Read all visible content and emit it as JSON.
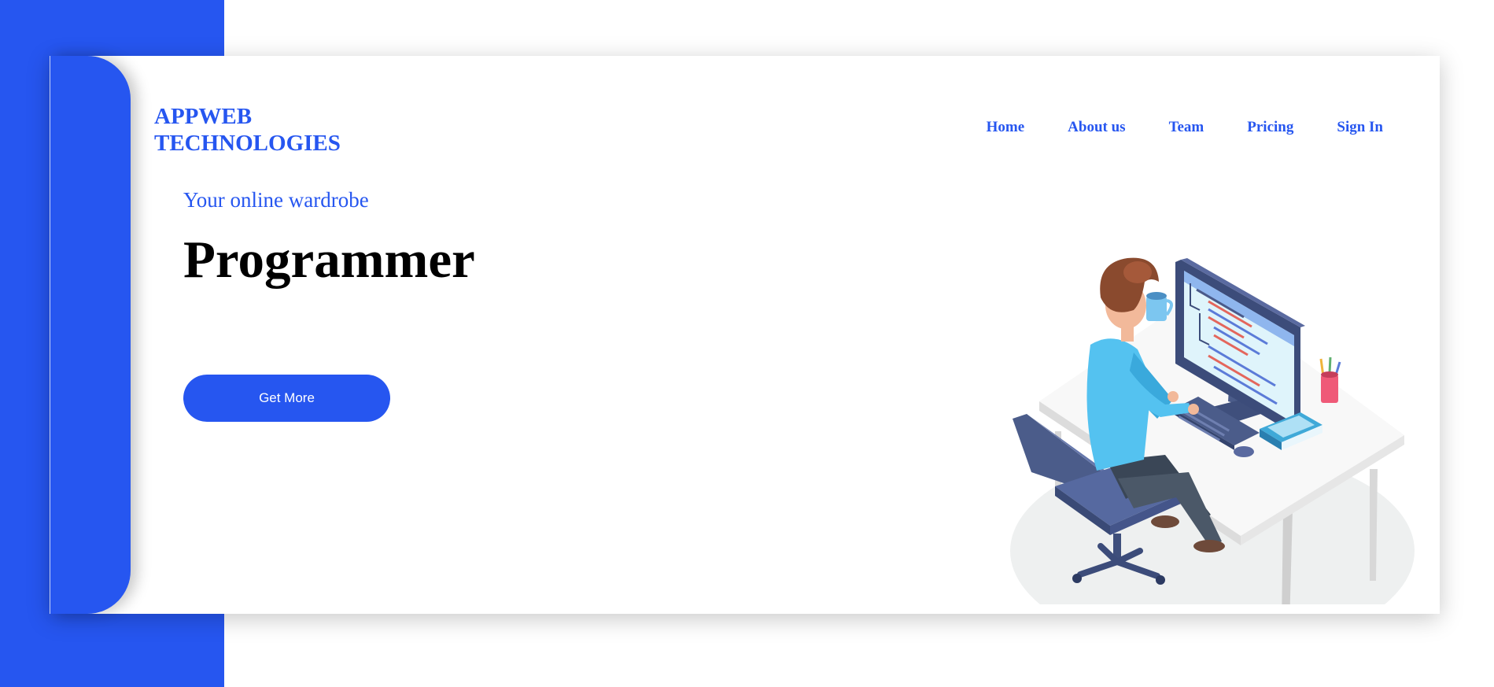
{
  "brand": {
    "line1": "APPWEB",
    "line2": "TECHNOLOGIES",
    "color": "#2656f0"
  },
  "nav": {
    "items": [
      {
        "label": "Home"
      },
      {
        "label": "About us"
      },
      {
        "label": "Team"
      },
      {
        "label": "Pricing"
      },
      {
        "label": "Sign In"
      }
    ]
  },
  "hero": {
    "tagline": "Your online wardrobe",
    "headline": "Programmer",
    "cta_label": "Get More",
    "illustration_icon": "programmer-at-desk-illustration"
  },
  "colors": {
    "accent": "#2656f0",
    "background": "#ffffff",
    "headline": "#000000"
  }
}
